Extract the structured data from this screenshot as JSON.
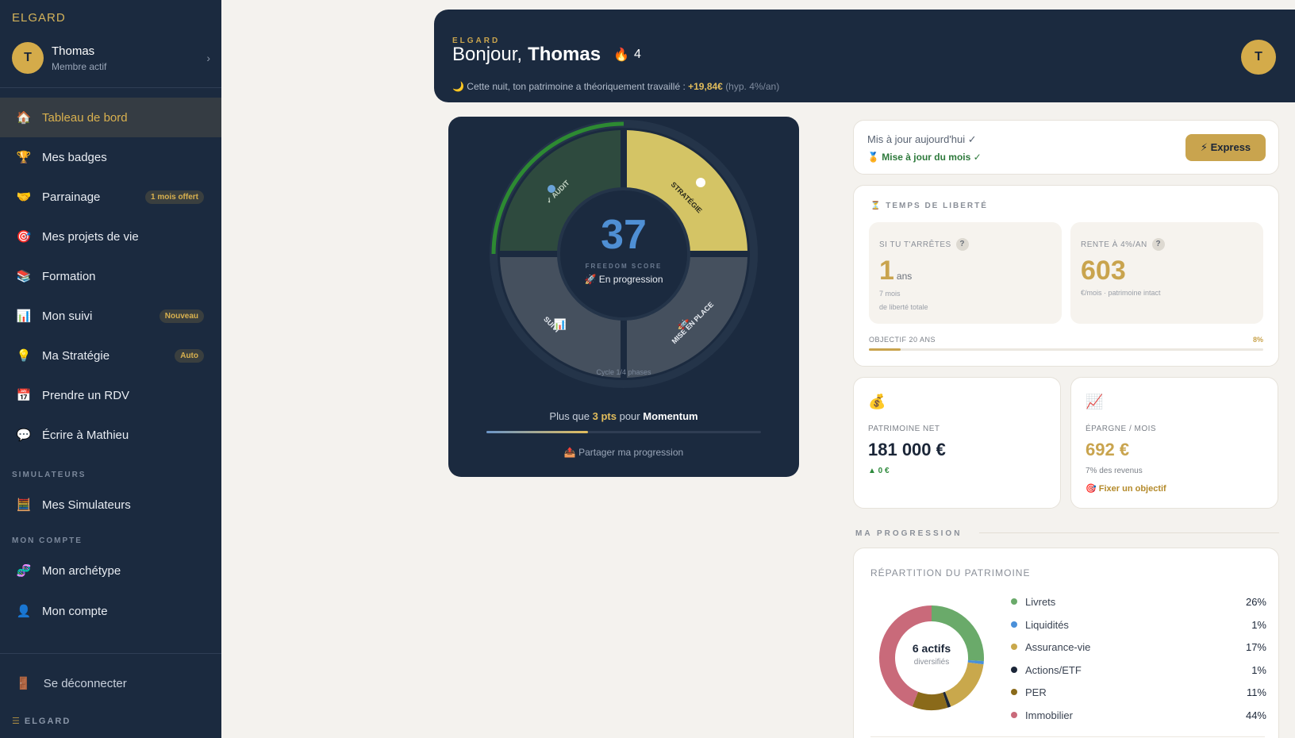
{
  "sidebar": {
    "brand": "ELGARD",
    "user": {
      "initial": "T",
      "name": "Thomas",
      "status": "Membre actif"
    },
    "nav": [
      {
        "label": "Tableau de bord",
        "icon": "🏠"
      },
      {
        "label": "Mes badges",
        "icon": "🏆"
      },
      {
        "label": "Parrainage",
        "icon": "🤝",
        "badge": "1 mois offert"
      },
      {
        "label": "Mes projets de vie",
        "icon": "🎯"
      },
      {
        "label": "Formation",
        "icon": "📚"
      },
      {
        "label": "Mon suivi",
        "icon": "📊",
        "badge": "Nouveau"
      },
      {
        "label": "Ma Stratégie",
        "icon": "💡",
        "badge": "Auto"
      },
      {
        "label": "Prendre un RDV",
        "icon": "📅"
      },
      {
        "label": "Écrire à Mathieu",
        "icon": "💬"
      },
      {
        "label": "Mes Simulateurs",
        "icon": "🧮"
      },
      {
        "label": "Mon archétype",
        "icon": "🧬"
      },
      {
        "label": "Mon compte",
        "icon": "👤"
      }
    ],
    "section_simulateurs": "SIMULATEURS",
    "section_compte": "MON COMPTE",
    "logout": {
      "label": "Se déconnecter",
      "icon": "🚪"
    },
    "footer_brand": "ELGARD"
  },
  "header": {
    "brand": "ELGARD",
    "greeting": "Bonjour,",
    "name": "Thomas",
    "streak": "4",
    "sub_text": "Cette nuit, ton patrimoine a théoriquement travaillé :",
    "gain": "+19,84€",
    "hyp": "(hyp. 4%/an)",
    "avatar_initial": "T"
  },
  "score": {
    "value": "37",
    "label": "FREEDOM SCORE",
    "status": "🚀 En progression",
    "phases": [
      "✓ AUDIT",
      "STRATÉGIE",
      "MISE EN PLACE",
      "SUIVI"
    ],
    "cycle": "Cycle 1/4 phases",
    "momentum_pre": "Plus que",
    "momentum_pts": "3 pts",
    "momentum_mid": "pour",
    "momentum_target": "Momentum",
    "momentum_progress": 0.37,
    "share": "📤 Partager ma progression"
  },
  "update": {
    "line1": "Mis à jour aujourd'hui ✓",
    "line2": "🏅 Mise à jour du mois ✓",
    "button": "⚡ Express"
  },
  "freedom_time": {
    "title": "⏳ TEMPS DE LIBERTÉ",
    "stop": {
      "caption": "SI TU T'ARRÊTES",
      "value": "1",
      "unit": "ans",
      "sub1": "7 mois",
      "sub2": "de liberté totale"
    },
    "rent": {
      "caption": "RENTE À 4%/AN",
      "value": "603",
      "sub1": "€/mois · patrimoine intact"
    },
    "objective_label": "OBJECTIF 20 ANS",
    "objective_pct": "8%",
    "objective_progress": 0.08
  },
  "kpis": {
    "net": {
      "icon": "💰",
      "label": "PATRIMOINE NET",
      "value": "181 000 €",
      "sub": "▲ 0 €"
    },
    "savings": {
      "icon": "📈",
      "label": "ÉPARGNE / MOIS",
      "value": "692 €",
      "sub": "7% des revenus",
      "link": "🎯 Fixer un objectif"
    }
  },
  "progression_title": "MA PROGRESSION",
  "repartition": {
    "title": "RÉPARTITION DU PATRIMOINE",
    "center_value": "6 actifs",
    "center_sub": "diversifiés",
    "items": [
      {
        "label": "Livrets",
        "pct": "26%",
        "value": 26,
        "color": "#6aaa6a"
      },
      {
        "label": "Liquidités",
        "pct": "1%",
        "value": 1,
        "color": "#4a90d9"
      },
      {
        "label": "Assurance-vie",
        "pct": "17%",
        "value": 17,
        "color": "#c9a84c"
      },
      {
        "label": "Actions/ETF",
        "pct": "1%",
        "value": 1,
        "color": "#1b2638"
      },
      {
        "label": "PER",
        "pct": "11%",
        "value": 11,
        "color": "#8a6a1a"
      },
      {
        "label": "Immobilier",
        "pct": "44%",
        "value": 44,
        "color": "#c96a7a"
      }
    ]
  },
  "colors": {
    "navy": "#1b2a3f",
    "gold": "#c9a44e",
    "green": "#2e7a3c"
  }
}
